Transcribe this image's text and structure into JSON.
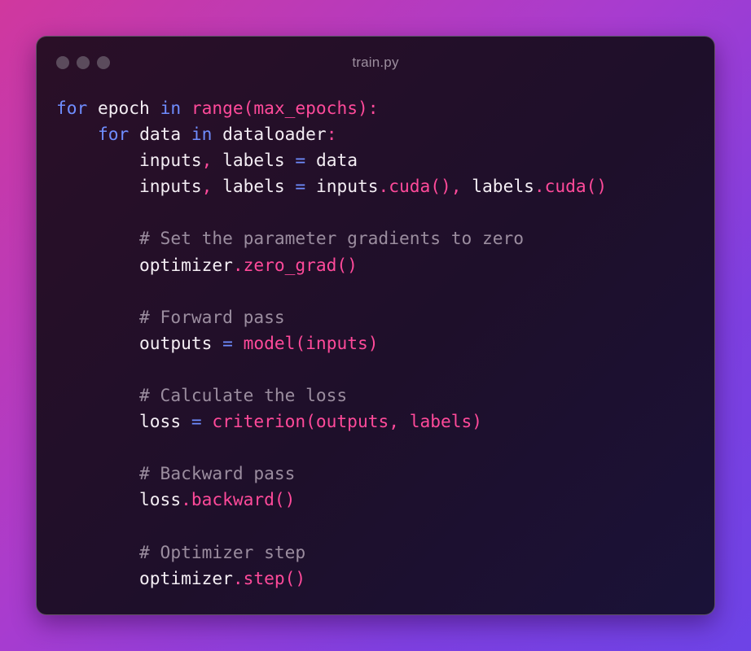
{
  "window": {
    "title": "train.py",
    "controls": [
      "close",
      "minimize",
      "maximize"
    ]
  },
  "colors": {
    "keyword": "#6f8dff",
    "function": "#ff4a9a",
    "comment": "#9b8d9f",
    "text": "#f4eef4"
  },
  "code": {
    "lines": [
      [
        "for",
        " epoch ",
        "in",
        " ",
        "range(max_epochs):"
      ],
      [
        "    ",
        "for",
        " data ",
        "in",
        " dataloader",
        ":"
      ],
      [
        "        inputs",
        ",",
        " labels ",
        "=",
        " data"
      ],
      [
        "        inputs",
        ",",
        " labels ",
        "=",
        " inputs",
        ".cuda(), ",
        "labels",
        ".cuda()"
      ],
      [
        ""
      ],
      [
        "        # Set the parameter gradients to zero"
      ],
      [
        "        optimizer",
        ".zero_grad()"
      ],
      [
        ""
      ],
      [
        "        # Forward pass"
      ],
      [
        "        outputs ",
        "=",
        " ",
        "model(inputs)"
      ],
      [
        ""
      ],
      [
        "        # Calculate the loss"
      ],
      [
        "        loss ",
        "=",
        " ",
        "criterion(outputs, labels)"
      ],
      [
        ""
      ],
      [
        "        # Backward pass"
      ],
      [
        "        loss",
        ".backward()"
      ],
      [
        ""
      ],
      [
        "        # Optimizer step"
      ],
      [
        "        optimizer",
        ".step()"
      ]
    ]
  }
}
